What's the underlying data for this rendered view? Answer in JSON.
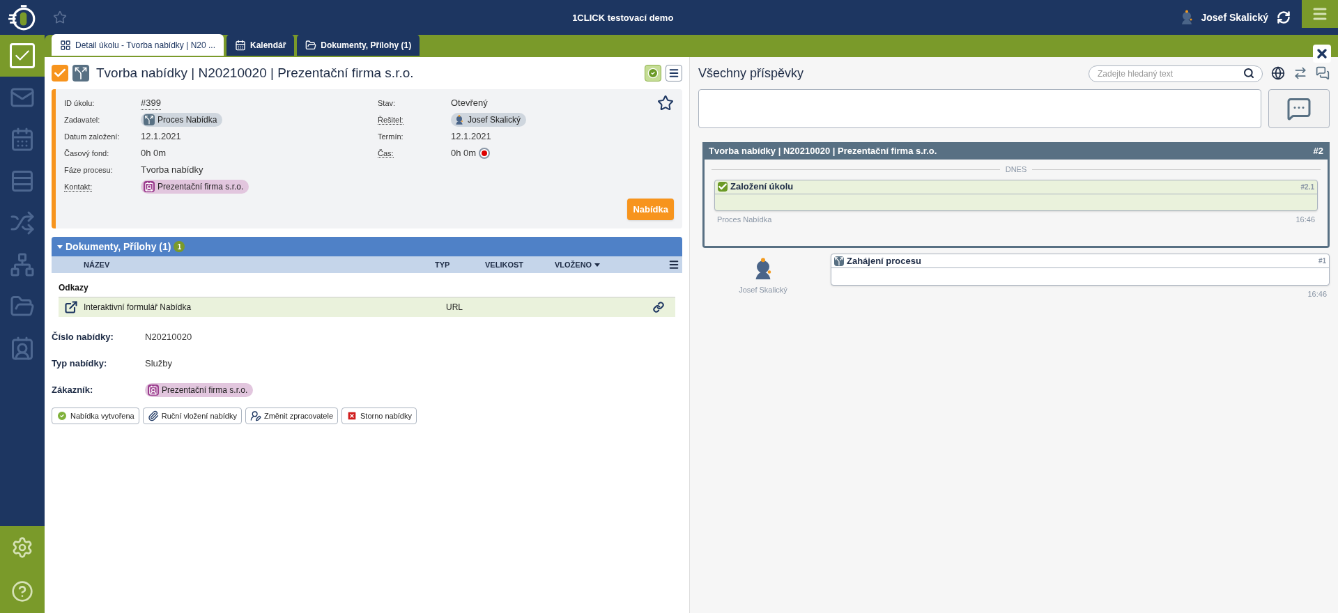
{
  "header": {
    "title": "1CLICK testovací demo",
    "user": "Josef Skalický"
  },
  "tabs": [
    {
      "label": "Detail úkolu - Tvorba nabídky | N20 ...",
      "selected": true,
      "kind": "grid"
    },
    {
      "label": "Kalendář",
      "selected": false,
      "kind": "calendar"
    },
    {
      "label": "Dokumenty, Přílohy (1)",
      "selected": false,
      "kind": "folder"
    }
  ],
  "sidebar": {
    "items": [
      {
        "kind": "tasks",
        "selected": true
      },
      {
        "kind": "mail",
        "selected": false
      },
      {
        "kind": "calendar",
        "selected": false
      },
      {
        "kind": "list",
        "selected": false
      },
      {
        "kind": "process",
        "selected": false
      },
      {
        "kind": "org",
        "selected": false
      },
      {
        "kind": "folder",
        "selected": false
      },
      {
        "kind": "contacts",
        "selected": false
      }
    ]
  },
  "task": {
    "title": "Tvorba nabídky | N20210020 | Prezentační firma s.r.o.",
    "fields_left": [
      {
        "label": "ID úkolu:",
        "value": "#399",
        "kind": "link",
        "underlined": false
      },
      {
        "label": "Zadavatel:",
        "value": "Proces Nabídka",
        "kind": "process",
        "underlined": false
      },
      {
        "label": "Datum založení:",
        "value": "12.1.2021",
        "kind": "text",
        "underlined": false
      },
      {
        "label": "Časový fond:",
        "value": "0h 0m",
        "kind": "text",
        "underlined": false
      },
      {
        "label": "Fáze procesu:",
        "value": "Tvorba nabídky",
        "kind": "text",
        "underlined": false
      },
      {
        "label": "Kontakt:",
        "value": "Prezentační firma s.r.o.",
        "kind": "contact",
        "underlined": true
      }
    ],
    "fields_right": [
      {
        "label": "Stav:",
        "value": "Otevřený",
        "kind": "text",
        "underlined": false
      },
      {
        "label": "Řešitel:",
        "value": "Josef Skalický",
        "kind": "user",
        "underlined": true
      },
      {
        "label": "Termín:",
        "value": "12.1.2021",
        "kind": "text",
        "underlined": false
      },
      {
        "label": "Čas:",
        "value": "0h 0m",
        "kind": "timer",
        "underlined": true
      }
    ],
    "action": "Nabídka"
  },
  "documents": {
    "title": "Dokumenty, Přílohy (1)",
    "count": "1",
    "columns": [
      "NÁZEV",
      "TYP",
      "VELIKOST",
      "VLOŽENO"
    ],
    "group": "Odkazy",
    "rows": [
      {
        "name": "Interaktivní formulář Nabídka",
        "type": "URL"
      }
    ]
  },
  "details": [
    {
      "label": "Číslo nabídky:",
      "value": "N20210020",
      "kind": "text"
    },
    {
      "label": "Typ nabídky:",
      "value": "Služby",
      "kind": "text"
    },
    {
      "label": "Zákazník:",
      "value": "Prezentační firma s.r.o.",
      "kind": "contact"
    }
  ],
  "buttons": [
    {
      "label": "Nabídka vytvořena",
      "kind": "ok"
    },
    {
      "label": "Ruční vložení nabídky",
      "kind": "attach"
    },
    {
      "label": "Změnit zpracovatele",
      "kind": "user"
    },
    {
      "label": "Storno nabídky",
      "kind": "cancel"
    }
  ],
  "feed": {
    "title": "Všechny příspěvky",
    "search": {
      "placeholder": "Zadejte hledaný text"
    },
    "thread": {
      "title": "Tvorba nabídky | N20210020 | Prezentační firma s.r.o.",
      "number": "#2",
      "day": "DNES",
      "posts": [
        {
          "title": "Založení úkolu",
          "number": "#2.1",
          "source": "Proces Nabídka",
          "time": "16:46"
        }
      ]
    },
    "posts": [
      {
        "author": "Josef Skalický",
        "title": "Zahájení procesu",
        "number": "#1",
        "time": "16:46"
      }
    ]
  }
}
